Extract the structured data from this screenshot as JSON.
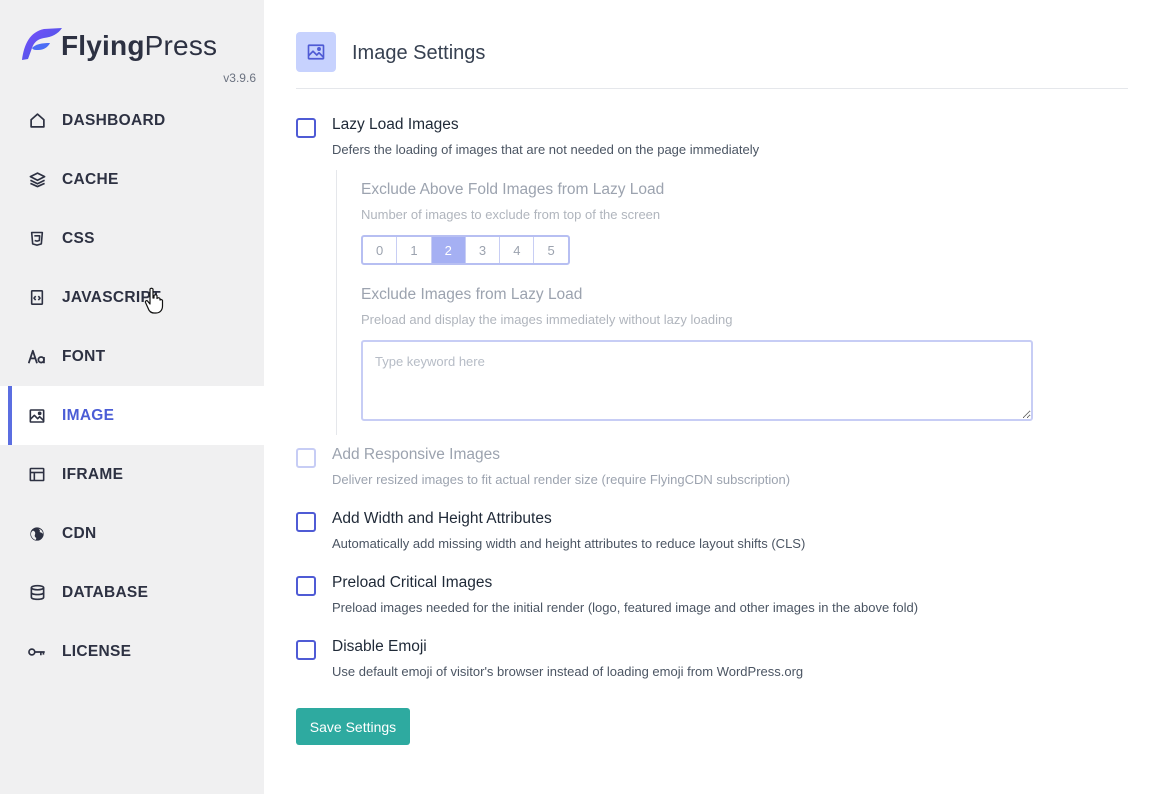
{
  "brand": {
    "name_bold": "Flying",
    "name_regular": "Press",
    "version": "v3.9.6"
  },
  "sidebar": {
    "items": [
      {
        "label": "DASHBOARD",
        "icon": "home-icon"
      },
      {
        "label": "CACHE",
        "icon": "layers-icon"
      },
      {
        "label": "CSS",
        "icon": "css-icon"
      },
      {
        "label": "JAVASCRIPT",
        "icon": "code-file-icon"
      },
      {
        "label": "FONT",
        "icon": "font-icon"
      },
      {
        "label": "IMAGE",
        "icon": "image-icon",
        "active": true
      },
      {
        "label": "IFRAME",
        "icon": "browser-window-icon"
      },
      {
        "label": "CDN",
        "icon": "globe-icon"
      },
      {
        "label": "DATABASE",
        "icon": "database-icon"
      },
      {
        "label": "LICENSE",
        "icon": "key-icon"
      }
    ]
  },
  "page": {
    "title": "Image Settings",
    "icon": "image-icon"
  },
  "options": {
    "lazy_load": {
      "title": "Lazy Load Images",
      "desc": "Defers the loading of images that are not needed on the page immediately",
      "checked": false
    },
    "exclude_fold": {
      "title": "Exclude Above Fold Images from Lazy Load",
      "desc": "Number of images to exclude from top of the screen",
      "choices": [
        "0",
        "1",
        "2",
        "3",
        "4",
        "5"
      ],
      "selected": "2"
    },
    "exclude_images": {
      "title": "Exclude Images from Lazy Load",
      "desc": "Preload and display the images immediately without lazy loading",
      "placeholder": "Type keyword here",
      "value": ""
    },
    "responsive": {
      "title": "Add Responsive Images",
      "desc": "Deliver resized images to fit actual render size (require FlyingCDN subscription)",
      "checked": false,
      "disabled": true
    },
    "dimensions": {
      "title": "Add Width and Height Attributes",
      "desc": "Automatically add missing width and height attributes to reduce layout shifts (CLS)",
      "checked": false
    },
    "preload": {
      "title": "Preload Critical Images",
      "desc": "Preload images needed for the initial render (logo, featured image and other images in the above fold)",
      "checked": false
    },
    "emoji": {
      "title": "Disable Emoji",
      "desc": "Use default emoji of visitor's browser instead of loading emoji from WordPress.org",
      "checked": false
    }
  },
  "actions": {
    "save_label": "Save Settings"
  },
  "colors": {
    "accent": "#4f5bd5",
    "save": "#2eaaa0",
    "sidebar_bg": "#f0f0f1",
    "selected_seg": "#a5b0f3"
  }
}
